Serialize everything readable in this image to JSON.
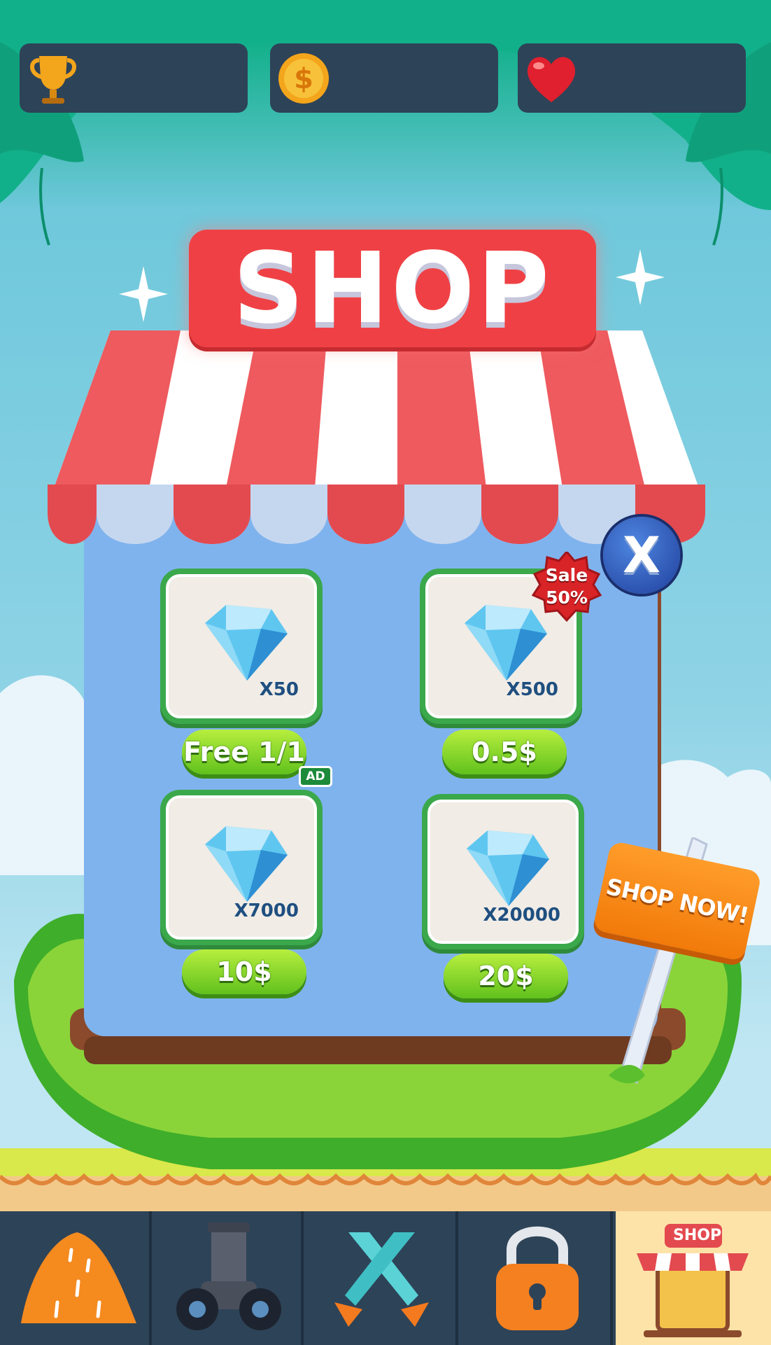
{
  "hud": {
    "trophy": {
      "icon": "trophy-icon",
      "value": ""
    },
    "coins": {
      "icon": "coin-icon",
      "value": ""
    },
    "lives": {
      "icon": "heart-icon",
      "value": ""
    }
  },
  "shop": {
    "title": "SHOP",
    "close_label": "X",
    "items": [
      {
        "quantity": "X50",
        "price": "Free 1/1",
        "badge": "AD",
        "icon": "diamond-icon"
      },
      {
        "quantity": "X500",
        "price": "0.5$",
        "sale": "Sale\n50%",
        "icon": "diamond-icon"
      },
      {
        "quantity": "X7000",
        "price": "10$",
        "icon": "diamond-icon"
      },
      {
        "quantity": "X20000",
        "price": "20$",
        "icon": "diamond-icon"
      }
    ],
    "sale_line1": "Sale",
    "sale_line2": "50%",
    "sign_text": "SHOP NOW!"
  },
  "nav": {
    "items": [
      {
        "name": "hill-icon"
      },
      {
        "name": "cannon-icon"
      },
      {
        "name": "crossed-swords-icon"
      },
      {
        "name": "lock-icon"
      },
      {
        "name": "shop-icon",
        "label": "SHOP",
        "active": true
      }
    ]
  },
  "colors": {
    "hud_panel": "#2d4358",
    "title_red": "#ef4145",
    "card_border": "#3aa84b",
    "button_green": "#61c11d",
    "nav_active": "#fde3a8"
  }
}
